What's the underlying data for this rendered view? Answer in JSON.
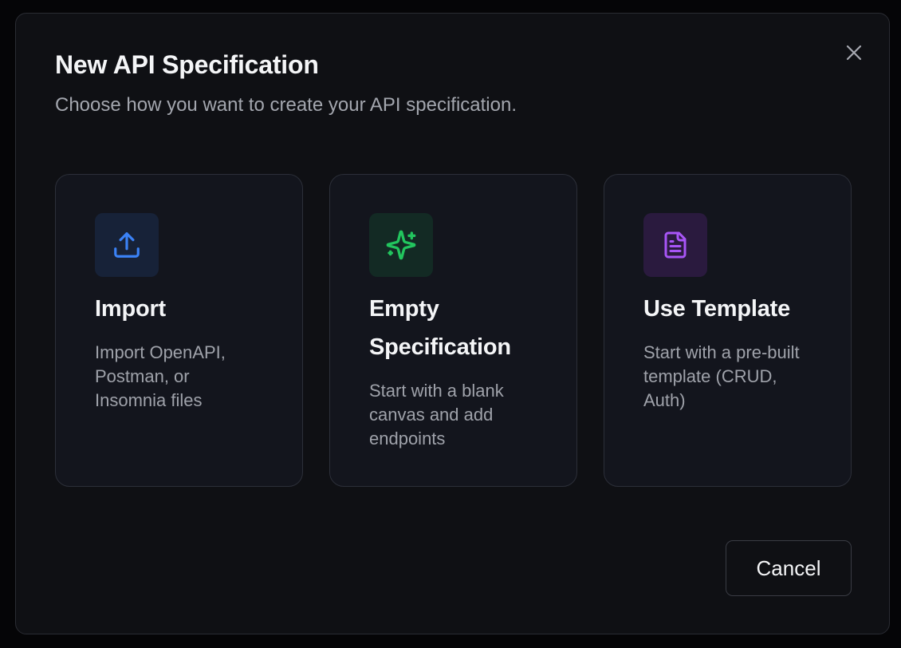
{
  "dialog": {
    "title": "New API Specification",
    "subtitle": "Choose how you want to create your API specification.",
    "close_icon": "close-icon",
    "cancel_label": "Cancel"
  },
  "options": [
    {
      "title": "Import",
      "description": "Import OpenAPI, Postman, or Insomnia files",
      "icon": "upload-icon",
      "accent": "#3b82f6"
    },
    {
      "title": "Empty Specification",
      "description": "Start with a blank canvas and add endpoints",
      "icon": "sparkles-icon",
      "accent": "#22c55e"
    },
    {
      "title": "Use Template",
      "description": "Start with a pre-built template (CRUD, Auth)",
      "icon": "file-text-icon",
      "accent": "#a855f7"
    }
  ],
  "colors": {
    "backdrop": "#050507",
    "modal_bg": "#0f1014",
    "card_bg": "#13151d",
    "border": "#2c2f39",
    "text_primary": "#f4f5f7",
    "text_secondary": "#a3a6ae"
  }
}
